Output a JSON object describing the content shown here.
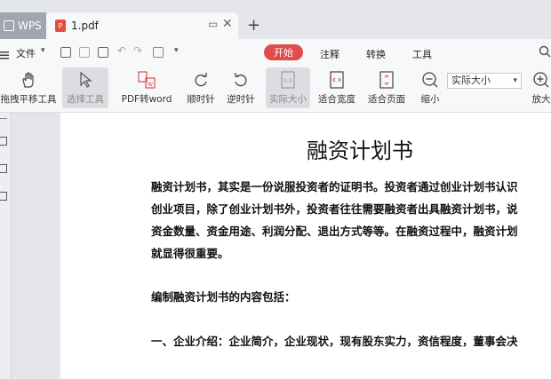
{
  "tabs": {
    "wps_label": "WPS",
    "doc_label": "1.pdf",
    "new_tab": "+"
  },
  "menu": {
    "file": "文件",
    "start": "开始",
    "annotate": "注释",
    "convert": "转换",
    "tools": "工具"
  },
  "toolbar": {
    "pan": "拖拽平移工具",
    "select": "选择工具",
    "pdf_to_word": "PDF转word",
    "rotate_cw": "顺时针",
    "rotate_ccw": "逆时针",
    "actual_size": "实际大小",
    "fit_width": "适合宽度",
    "fit_page": "适合页面",
    "zoom_out": "缩小",
    "zoom_select_value": "实际大小",
    "zoom_in": "放大"
  },
  "document": {
    "title": "融资计划书",
    "lines": [
      "融资计划书，其实是一份说服投资者的证明书。投资者通过创业计划书认识",
      "创业项目，除了创业计划书外，投资者往往需要融资者出具融资计划书，说",
      "资金数量、资金用途、利润分配、退出方式等等。在融资过程中，融资计划",
      "就显得很重要。"
    ],
    "heading": "编制融资计划书的内容包括：",
    "item1": "一、企业介绍：企业简介，企业现状，现有股东实力，资信程度，董事会决"
  }
}
